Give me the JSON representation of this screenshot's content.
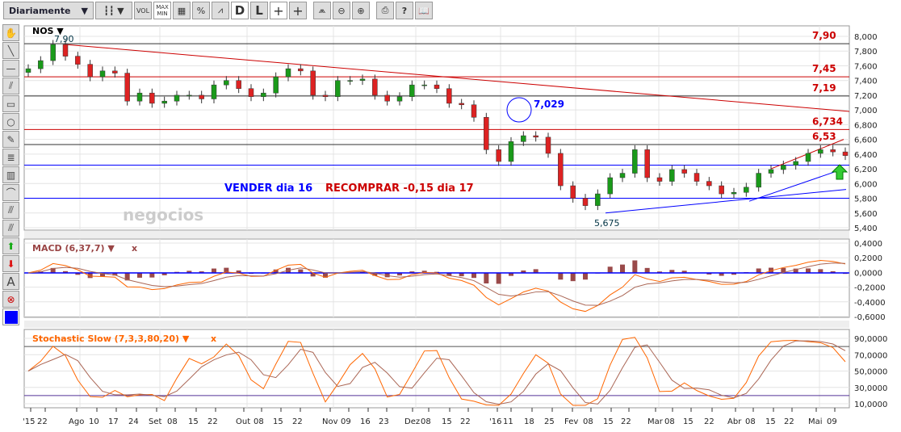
{
  "toolbar": {
    "period": "Diariamente",
    "buttons": [
      "candle-type",
      "VOL",
      "MAX MIN",
      "grid",
      "%",
      "area",
      "D",
      "L",
      "crosshair",
      "crosshair-L",
      "add-indicator",
      "zoom-out",
      "zoom-in",
      "print",
      "?",
      "book"
    ],
    "vol": "VOL",
    "max": "MAX",
    "min": "MIN",
    "pct": "%",
    "d": "D",
    "l": "L",
    "help": "?"
  },
  "sidebar": {
    "tools": [
      "hand",
      "line",
      "hline",
      "channel",
      "rectangle",
      "circle",
      "pencil",
      "fibonacci",
      "fib-grid",
      "arc",
      "parallel",
      "gann",
      "buy-arrow",
      "sell-arrow",
      "text",
      "delete",
      "color"
    ],
    "text_tool": "A",
    "color": "#0000ff"
  },
  "chart_data": {
    "type": "candlestick",
    "symbol": "NOS",
    "closes": [
      7560,
      7670,
      7890,
      7730,
      7620,
      7450,
      7530,
      7500,
      7120,
      7230,
      7090,
      7120,
      7200,
      7200,
      7150,
      7340,
      7400,
      7290,
      7180,
      7230,
      7450,
      7560,
      7530,
      7200,
      7180,
      7400,
      7400,
      7420,
      7200,
      7120,
      7180,
      7340,
      7340,
      7290,
      7090,
      7070,
      6900,
      6460,
      6300,
      6570,
      6650,
      6630,
      6410,
      5970,
      5800,
      5700,
      5860,
      6080,
      6140,
      6460,
      6080,
      6030,
      6190,
      6140,
      6030,
      5970,
      5860,
      5880,
      5950,
      6140,
      6190,
      6250,
      6300,
      6410,
      6460,
      6430,
      6380
    ],
    "ylim": [
      5400,
      8000
    ],
    "yticks": [
      "8,000",
      "7,800",
      "7,600",
      "7,400",
      "7,200",
      "7,000",
      "6,800",
      "6,600",
      "6,400",
      "6,200",
      "6,000",
      "5,800",
      "5,600",
      "5,400"
    ],
    "levels": [
      {
        "v": 7900,
        "label": "7,90",
        "color": "#000000"
      },
      {
        "v": 7450,
        "label": "7,45",
        "color": "#cc0000"
      },
      {
        "v": 7190,
        "label": "7,19",
        "color": "#000000"
      },
      {
        "v": 6734,
        "label": "6,734",
        "color": "#cc0000"
      },
      {
        "v": 6530,
        "label": "6,53",
        "color": "#000000"
      }
    ],
    "blue_levels": [
      6250,
      5800
    ],
    "annotations": {
      "high": "7,90",
      "low": "5,675",
      "circle": "7,029",
      "sell": "VENDER dia 16",
      "buy": "RECOMPRAR -0,15 dia 17",
      "watermark": "negocios"
    },
    "xticks": [
      "'15",
      "22",
      "Ago",
      "10",
      "17",
      "24",
      "Set",
      "08",
      "15",
      "22",
      "Out",
      "08",
      "15",
      "22",
      "Nov",
      "09",
      "16",
      "23",
      "Dez",
      "08",
      "15",
      "22",
      "'16",
      "11",
      "18",
      "25",
      "Fev",
      "08",
      "15",
      "22",
      "Mar",
      "08",
      "15",
      "22",
      "Abr",
      "08",
      "15",
      "22",
      "Mai",
      "09"
    ],
    "macd": {
      "title": "MACD (6,37,7)",
      "close": "x",
      "ylim": [
        -0.7,
        0.45
      ],
      "yticks": [
        "0,4000",
        "0,2000",
        "0,0000",
        "-0,2000",
        "-0,4000",
        "-0,6000"
      ]
    },
    "stoch": {
      "title": "Stochastic Slow (7,3,3,80,20)",
      "close": "x",
      "yticks": [
        "90,0000",
        "70,0000",
        "50,0000",
        "30,0000",
        "10,0000"
      ]
    }
  }
}
